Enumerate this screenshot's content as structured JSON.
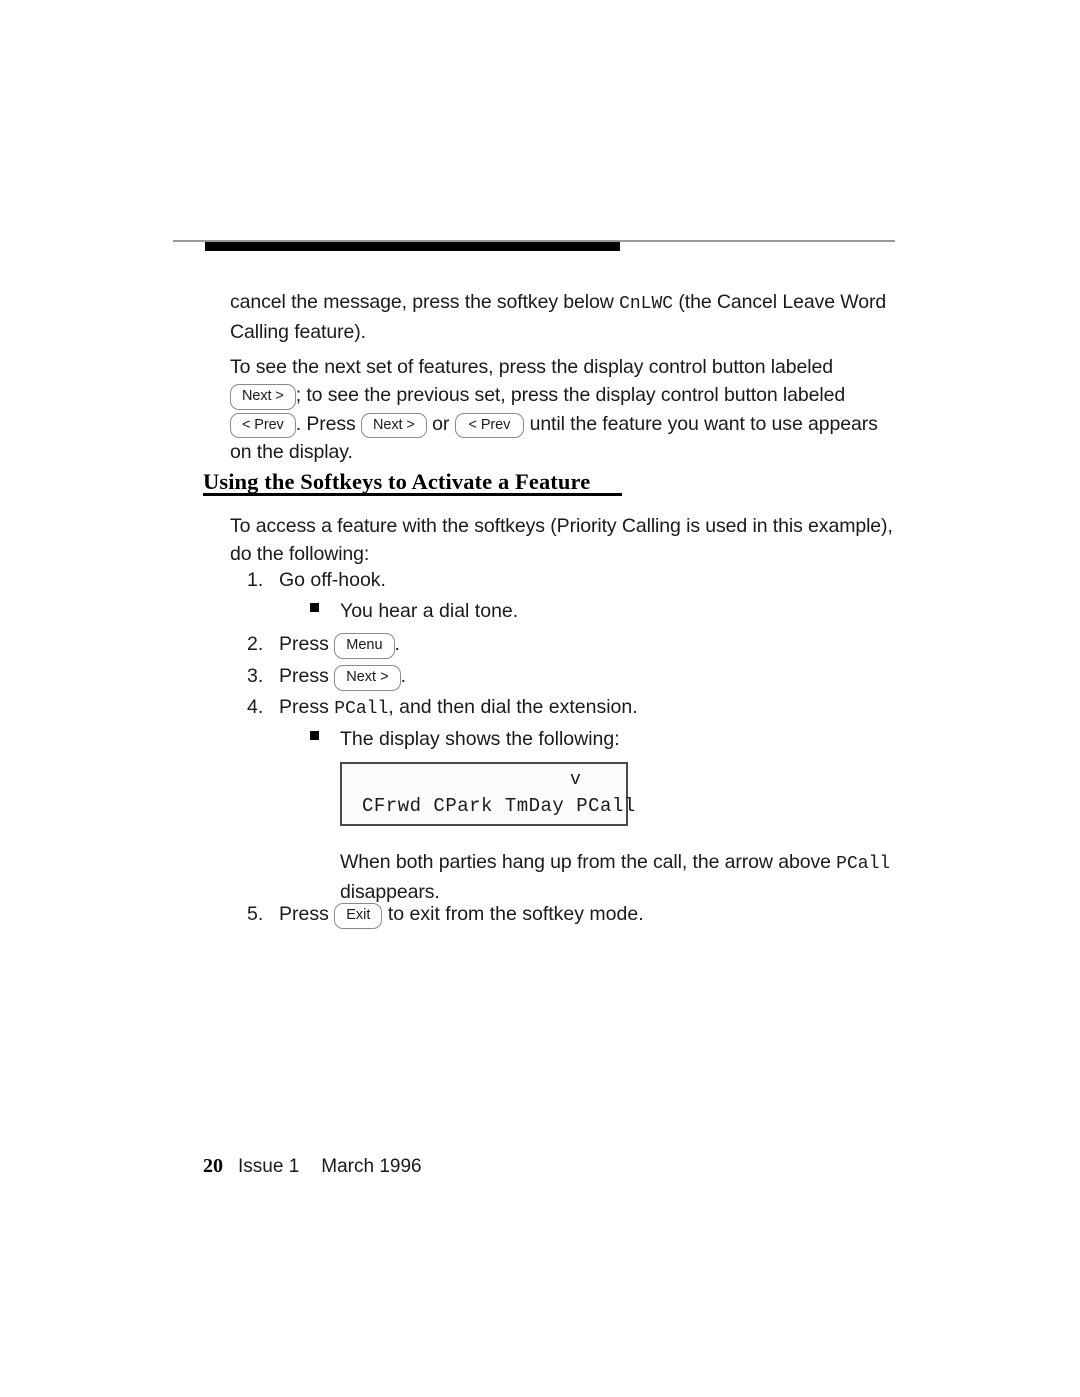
{
  "document": {
    "type": "printed-manual-page"
  },
  "paragraphs": {
    "p1_line1_a": "cancel the message, press the softkey below ",
    "p1_line1_mono": "CnLWC",
    "p1_line1_b": " (the Cancel Leave Word",
    "p1_line2": "Calling feature).",
    "p2_line1": "To see the next set of features, press the display control button labeled",
    "p2_line2_a": "; to see the previous set, press the display control button labeled",
    "p2_line3_a": ". Press ",
    "p2_line3_or": " or ",
    "p2_line3_b": " until the feature you want to use appears",
    "p2_line4": "on the display."
  },
  "section": {
    "heading": "Using the Softkeys to Activate a Feature",
    "intro_line1": "To access a feature with the softkeys (Priority Calling is used in this example),",
    "intro_line2": "do the following:"
  },
  "keys": {
    "next": "Next >",
    "prev": "< Prev",
    "menu": "Menu",
    "exit": "Exit"
  },
  "steps": [
    {
      "number": "1.",
      "text": "Go off-hook.",
      "bullet": "You hear a dial tone."
    },
    {
      "number": "2.",
      "text_before": "Press ",
      "key": "Menu",
      "text_after": "."
    },
    {
      "number": "3.",
      "text_before": "Press ",
      "key": "Next >",
      "text_after": "."
    },
    {
      "number": "4.",
      "text_before": "Press ",
      "mono": "PCall",
      "text_after": ", and then dial the extension.",
      "bullet": "The display shows the following:"
    },
    {
      "number": "5.",
      "text_before": "Press ",
      "key": "Exit",
      "text_after": " to exit from the softkey mode."
    }
  ],
  "phone_display": {
    "arrow_indicator": "v",
    "softkey_row": "CFrwd CPark TmDay PCall",
    "softkeys": [
      "CFrwd",
      "CPark",
      "TmDay",
      "PCall"
    ]
  },
  "note": {
    "line1_a": "When both parties hang up from the call, the arrow above ",
    "line1_mono": "PCall",
    "line2": "disappears."
  },
  "footer": {
    "page_number": "20",
    "issue": "Issue 1",
    "date": "March 1996"
  }
}
